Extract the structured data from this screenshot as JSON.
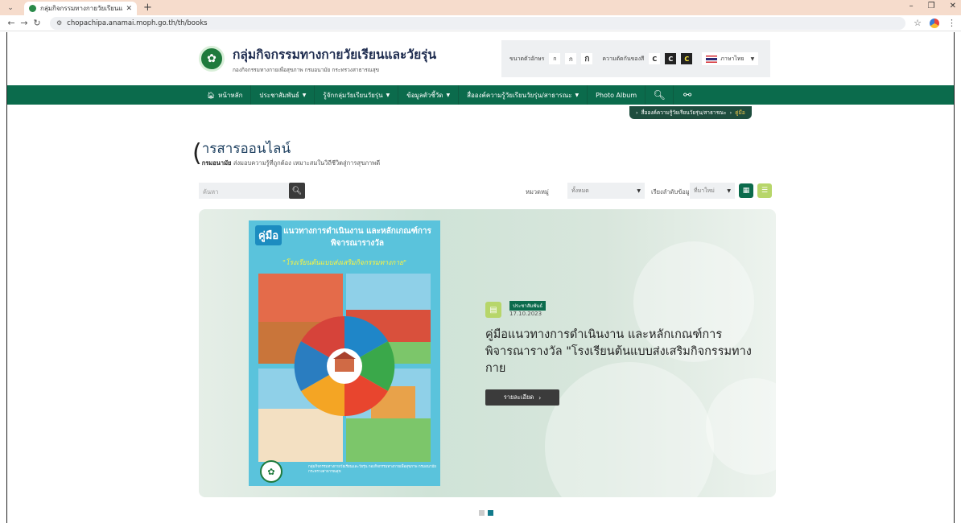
{
  "browser": {
    "tab_title": "กลุ่มกิจกรรมทางกายวัยเรียนและวัยรุ่น",
    "url": "chopachipa.anamai.moph.go.th/th/books"
  },
  "site": {
    "title": "กลุ่มกิจกรรมทางกายวัยเรียนและวัยรุ่น",
    "subtitle": "กองกิจกรรมทางกายเพื่อสุขภาพ กรมอนามัย กระทรวงสาธารณสุข",
    "font_size_label": "ขนาดตัวอักษร",
    "font_sizes": [
      "ก",
      "ก",
      "ก"
    ],
    "contrast_label": "ความตัดกันของสี",
    "contrast": [
      "C",
      "C",
      "C"
    ],
    "language": "ภาษาไทย"
  },
  "nav": {
    "home": "หน้าหลัก",
    "items": [
      "ประชาสัมพันธ์",
      "รู้จักกลุ่มวัยเรียนวัยรุ่น",
      "ข้อมูลตัวชี้วัด",
      "สื่อองค์ความรู้วัยเรียนวัยรุ่น/สาธารณะ",
      "Photo Album"
    ]
  },
  "breadcrumb": {
    "parent": "สื่อองค์ความรู้วัยเรียนวัยรุ่น/สาธารณะ",
    "current": "คู่มือ"
  },
  "page": {
    "title": "ารสารออนไลน์",
    "subtitle_bold": "กรมอนามัย",
    "subtitle": "ส่งมอบความรู้ที่ถูกต้อง เหมาะสมในวิถีชีวิตสู่การสุขภาพดี"
  },
  "filters": {
    "search_placeholder": "ค้นหา",
    "category_label": "หมวดหมู่",
    "category_value": "ทั้งหมด",
    "sort_label": "เรียงลำดับข้อมูล",
    "sort_value": "ที่มาใหม่"
  },
  "featured": {
    "cover_badge": "คู่มือ",
    "cover_heading": "แนวทางการดำเนินงาน และหลักเกณฑ์การพิจารณารางวัล",
    "cover_quote": "\"โรงเรียนต้นแบบส่งเสริมกิจกรรมทางกาย\"",
    "cover_footer": "กลุ่มกิจกรรมทางกายวัยเรียนและวัยรุ่น กองกิจกรรมทางกายเพื่อสุขภาพ กรมอนามัย กระทรวงสาธารณสุข",
    "category": "ประชาสัมพันธ์",
    "date": "17.10.2023",
    "title": "คู่มือแนวทางการดำเนินงาน และหลักเกณฑ์การพิจารณารางวัล \"โรงเรียนต้นแบบส่งเสริมกิจกรรมทางกาย",
    "detail_button": "รายละเอียด"
  },
  "slider": {
    "total": 2,
    "active": 2
  }
}
